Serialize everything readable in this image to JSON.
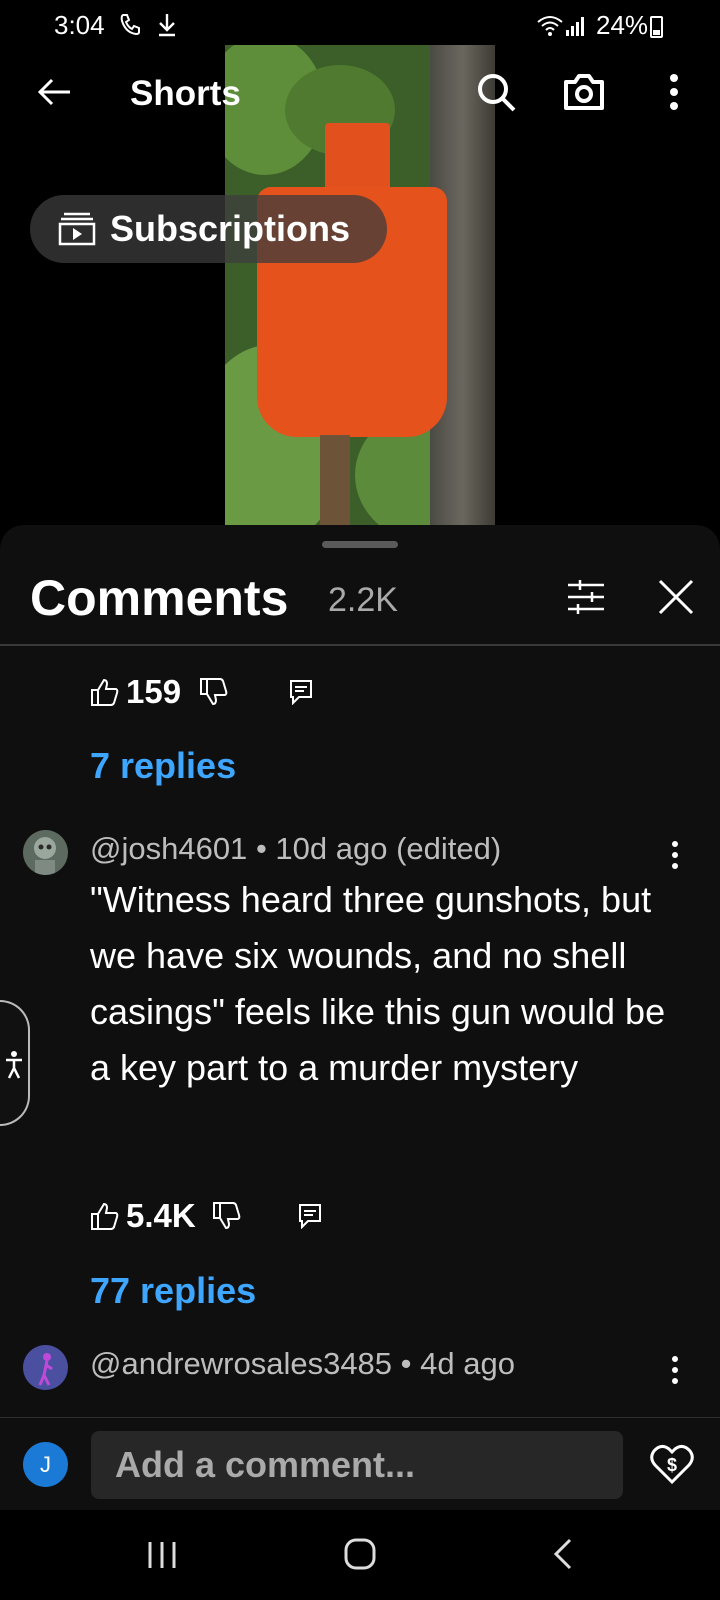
{
  "status_bar": {
    "time": "3:04",
    "battery": "24%",
    "left_icons": [
      "phone-call-icon",
      "download-icon"
    ],
    "right_icons": [
      "wifi-icon",
      "signal-icon",
      "battery-icon"
    ]
  },
  "header": {
    "title": "Shorts",
    "icons": [
      "back-arrow-icon",
      "search-icon",
      "camera-icon",
      "more-vert-icon"
    ]
  },
  "subscriptions_chip": {
    "label": "Subscriptions",
    "icon": "subscriptions-icon"
  },
  "comments_panel": {
    "title": "Comments",
    "count": "2.2K",
    "icons": [
      "filter-icon",
      "close-icon"
    ],
    "partial_comment": {
      "likes": "159",
      "replies": "7 replies"
    },
    "comments": [
      {
        "author": "@josh4601",
        "time": "10d ago (edited)",
        "text": "\"Witness heard three gunshots, but we have six wounds, and no shell casings\" feels like this gun would be a key part to a murder mystery",
        "likes": "5.4K",
        "replies": "77 replies"
      },
      {
        "author": "@andrewrosales3485",
        "time": "4d ago"
      }
    ]
  },
  "composer": {
    "avatar_letter": "J",
    "placeholder": "Add a comment...",
    "thanks_icon": "heart-dollar-icon"
  },
  "nav_bar": {
    "icons": [
      "recents-icon",
      "home-icon",
      "back-icon"
    ]
  },
  "colors": {
    "link": "#3ea6ff",
    "target": "#e6521c",
    "sheet": "#0f0f0f"
  }
}
